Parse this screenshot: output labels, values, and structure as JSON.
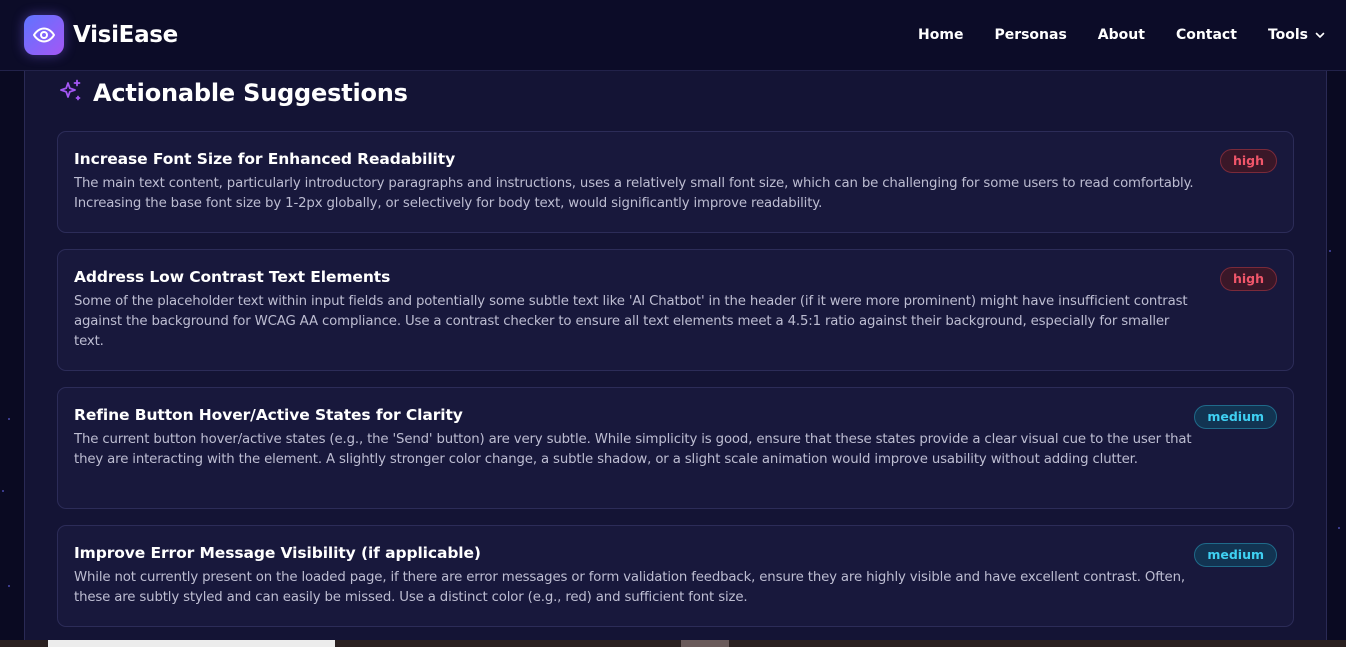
{
  "navbar": {
    "brand": "VisiEase",
    "links": [
      "Home",
      "Personas",
      "About",
      "Contact"
    ],
    "tools_label": "Tools"
  },
  "section": {
    "title": "Actionable Suggestions"
  },
  "suggestions": [
    {
      "title": "Increase Font Size for Enhanced Readability",
      "description": "The main text content, particularly introductory paragraphs and instructions, uses a relatively small font size, which can be challenging for some users to read comfortably. Increasing the base font size by 1-2px globally, or selectively for body text, would significantly improve readability.",
      "priority": "high"
    },
    {
      "title": "Address Low Contrast Text Elements",
      "description": "Some of the placeholder text within input fields and potentially some subtle text like 'AI Chatbot' in the header (if it were more prominent) might have insufficient contrast against the background for WCAG AA compliance. Use a contrast checker to ensure all text elements meet a 4.5:1 ratio against their background, especially for smaller text.",
      "priority": "high"
    },
    {
      "title": "Refine Button Hover/Active States for Clarity",
      "description": "The current button hover/active states (e.g., the 'Send' button) are very subtle. While simplicity is good, ensure that these states provide a clear visual cue to the user that they are interacting with the element. A slightly stronger color change, a subtle shadow, or a slight scale animation would improve usability without adding clutter.",
      "priority": "medium"
    },
    {
      "title": "Improve Error Message Visibility (if applicable)",
      "description": "While not currently present on the loaded page, if there are error messages or form validation feedback, ensure they are highly visible and have excellent contrast. Often, these are subtly styled and can easily be missed. Use a distinct color (e.g., red) and sufficient font size.",
      "priority": "medium"
    }
  ],
  "colors": {
    "background": "#0b0b26",
    "card": "#18183c",
    "high_badge_text": "#f0566a",
    "medium_badge_text": "#3fd0f2",
    "logo_gradient": [
      "#5f74ff",
      "#a457f5"
    ],
    "sparkle": "#a457f5"
  },
  "icons": {
    "logo": "eye-icon",
    "section": "sparkles-icon",
    "tools": "chevron-down-icon"
  }
}
